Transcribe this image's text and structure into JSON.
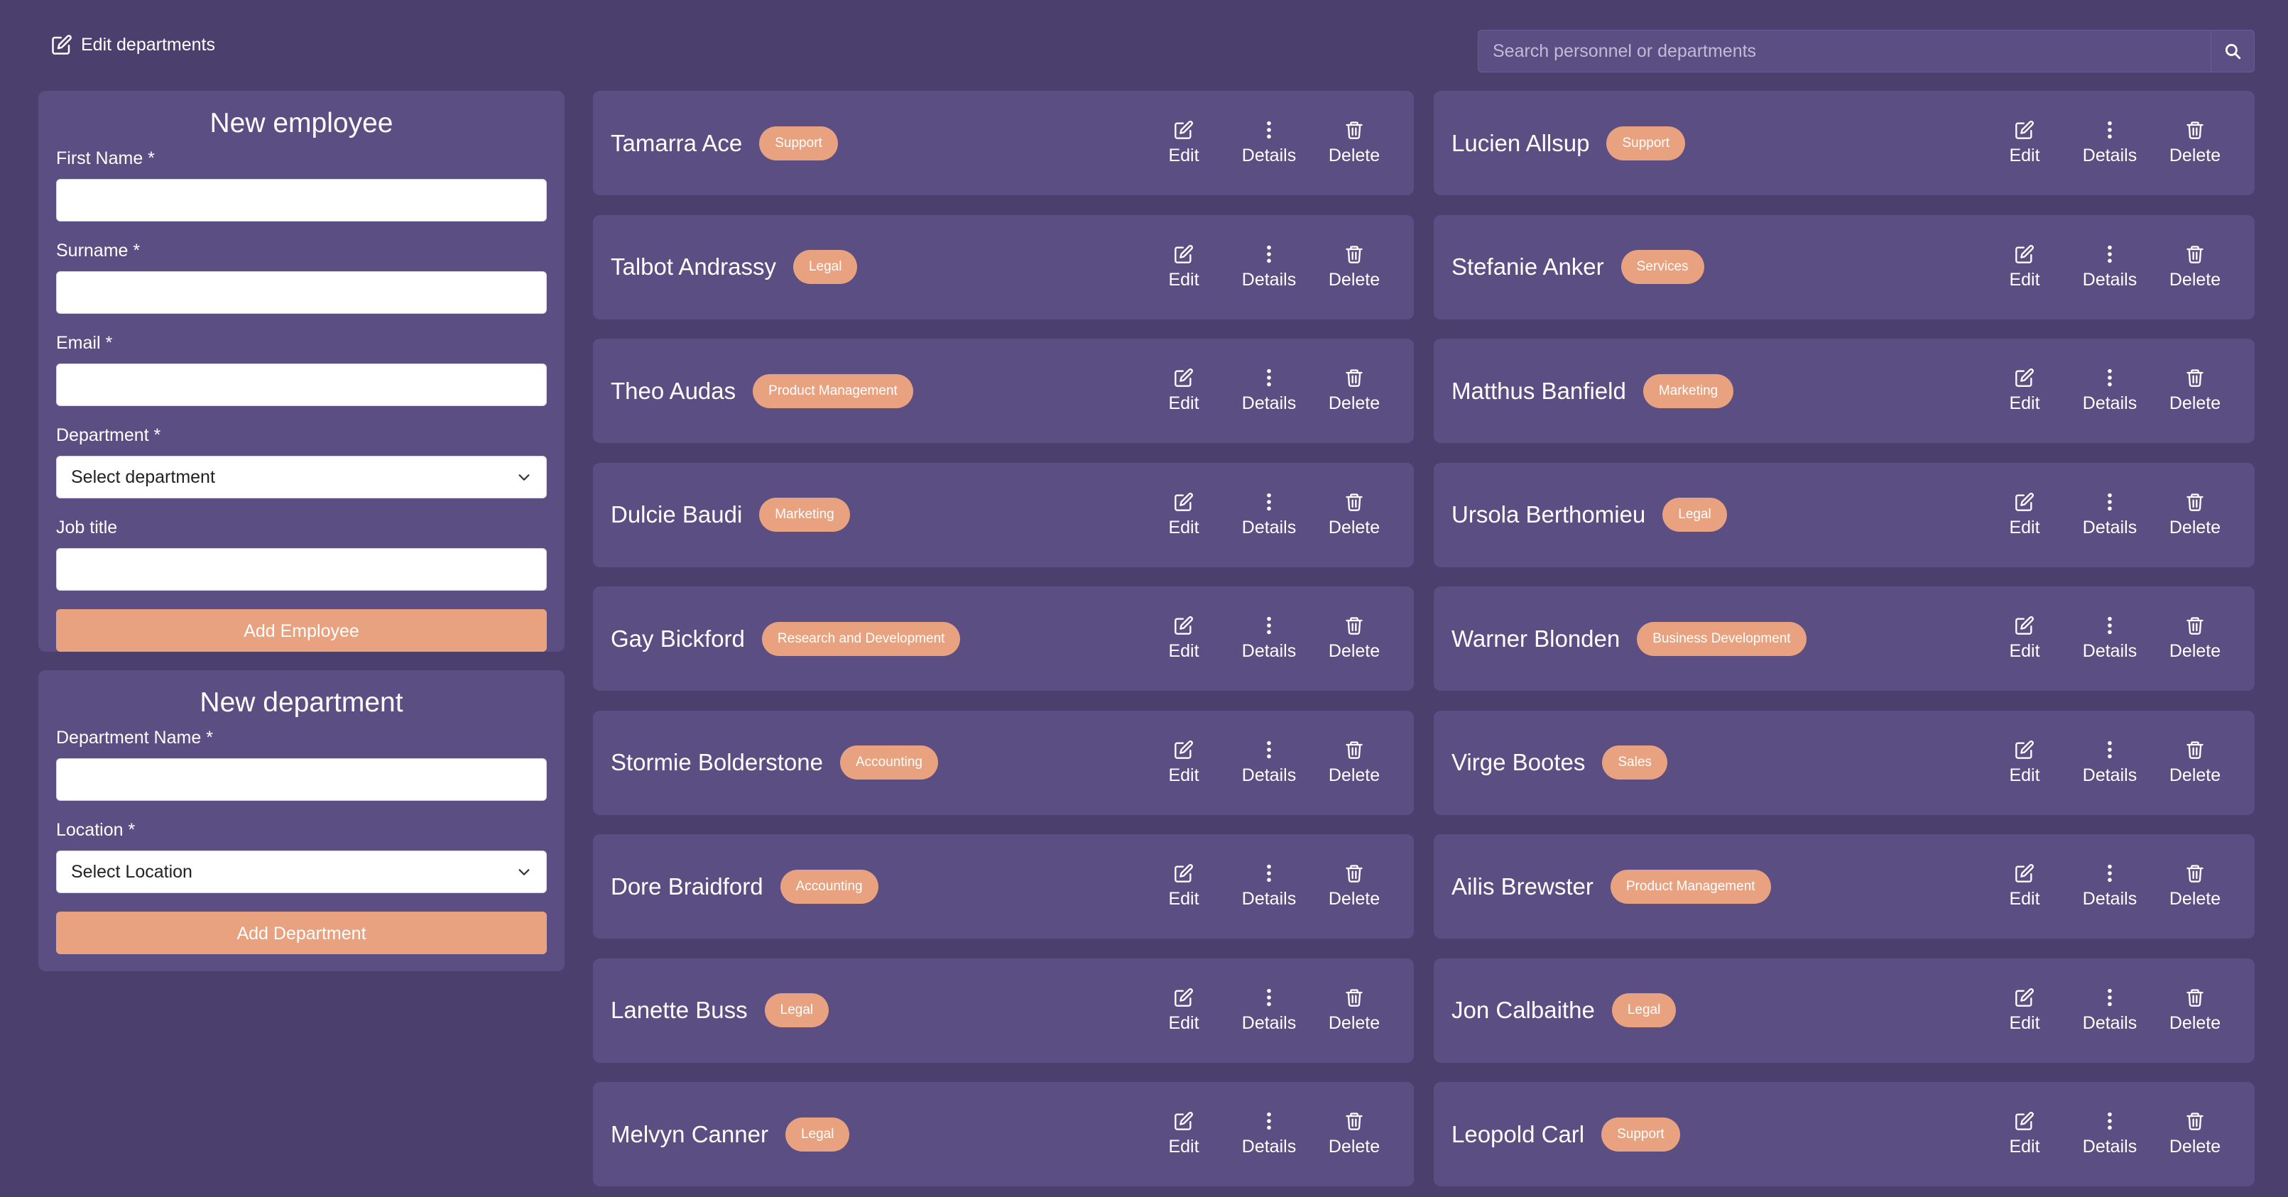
{
  "header": {
    "edit_departments_label": "Edit departments",
    "search_placeholder": "Search personnel or departments"
  },
  "new_employee": {
    "title": "New employee",
    "first_name_label": "First Name *",
    "surname_label": "Surname *",
    "email_label": "Email *",
    "department_label": "Department *",
    "department_select_value": "Select department",
    "job_title_label": "Job title",
    "submit_label": "Add Employee"
  },
  "new_department": {
    "title": "New department",
    "name_label": "Department Name *",
    "location_label": "Location *",
    "location_select_value": "Select Location",
    "submit_label": "Add Department"
  },
  "actions": {
    "edit": "Edit",
    "details": "Details",
    "delete": "Delete"
  },
  "colors": {
    "background": "#4b406d",
    "panel": "#5b4e82",
    "accent": "#e9a27f"
  },
  "personnel": [
    {
      "name": "Tamarra Ace",
      "department": "Support"
    },
    {
      "name": "Lucien Allsup",
      "department": "Support"
    },
    {
      "name": "Talbot Andrassy",
      "department": "Legal"
    },
    {
      "name": "Stefanie Anker",
      "department": "Services"
    },
    {
      "name": "Theo Audas",
      "department": "Product Management"
    },
    {
      "name": "Matthus Banfield",
      "department": "Marketing"
    },
    {
      "name": "Dulcie Baudi",
      "department": "Marketing"
    },
    {
      "name": "Ursola Berthomieu",
      "department": "Legal"
    },
    {
      "name": "Gay Bickford",
      "department": "Research and Development"
    },
    {
      "name": "Warner Blonden",
      "department": "Business Development"
    },
    {
      "name": "Stormie Bolderstone",
      "department": "Accounting"
    },
    {
      "name": "Virge Bootes",
      "department": "Sales"
    },
    {
      "name": "Dore Braidford",
      "department": "Accounting"
    },
    {
      "name": "Ailis Brewster",
      "department": "Product Management"
    },
    {
      "name": "Lanette Buss",
      "department": "Legal"
    },
    {
      "name": "Jon Calbaithe",
      "department": "Legal"
    },
    {
      "name": "Melvyn Canner",
      "department": "Legal"
    },
    {
      "name": "Leopold Carl",
      "department": "Support"
    }
  ]
}
